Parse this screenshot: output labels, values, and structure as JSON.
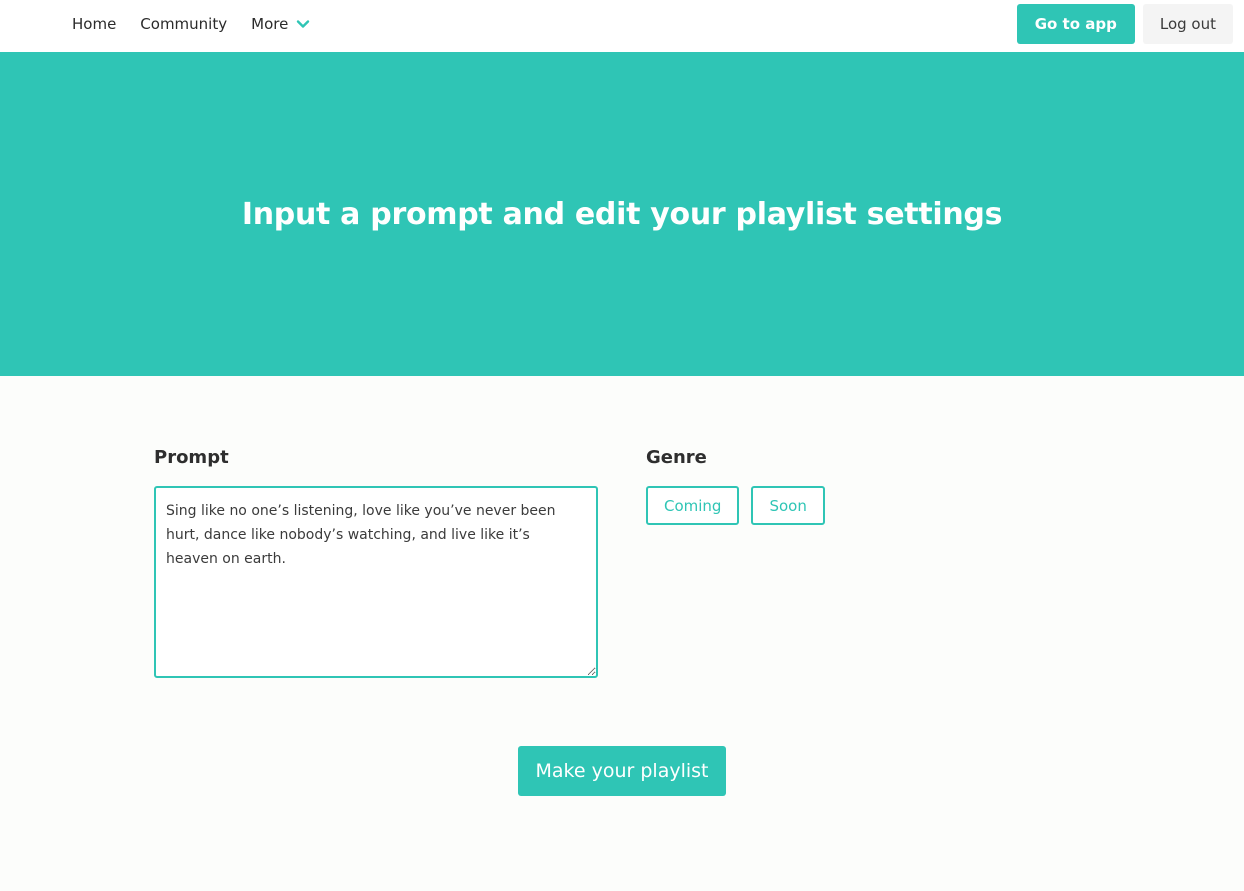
{
  "nav": {
    "links": [
      {
        "label": "Home"
      },
      {
        "label": "Community"
      },
      {
        "label": "More"
      }
    ],
    "more_icon": "chevron-down-icon",
    "go_to_app_label": "Go to app",
    "logout_label": "Log out"
  },
  "hero": {
    "title": "Input a prompt and edit your playlist settings"
  },
  "form": {
    "prompt_label": "Prompt",
    "prompt_value": "Sing like no one’s listening, love like you’ve never been hurt, dance like nobody’s watching, and live like it’s heaven on earth.",
    "genre_label": "Genre",
    "genre_options": [
      {
        "label": "Coming"
      },
      {
        "label": "Soon"
      }
    ],
    "submit_label": "Make your playlist"
  },
  "colors": {
    "accent": "#2fc5b5",
    "background": "#fcfdfb",
    "nav_background": "#ffffff",
    "light_button": "#f4f4f4"
  }
}
